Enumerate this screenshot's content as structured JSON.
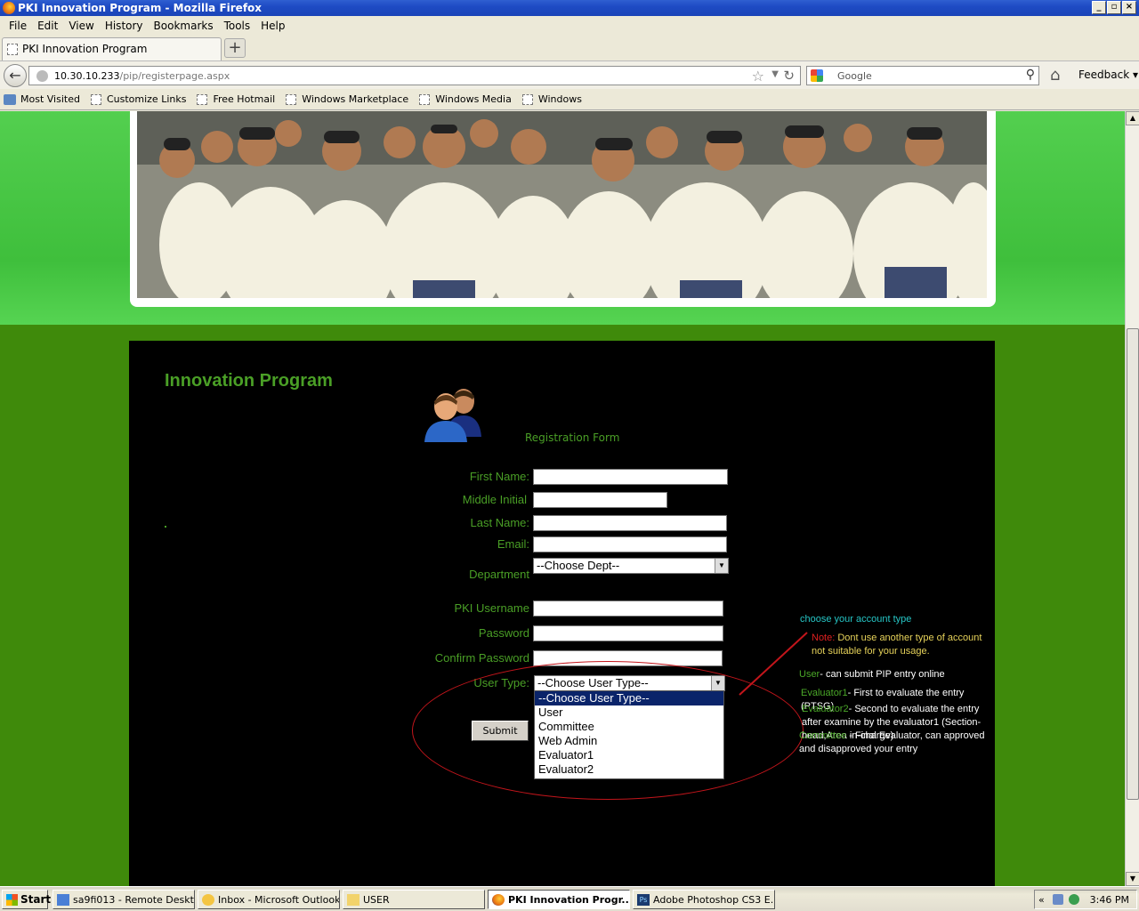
{
  "window": {
    "title": "PKI Innovation Program - Mozilla Firefox",
    "controls": [
      "_",
      "▫",
      "×"
    ]
  },
  "menu": [
    "File",
    "Edit",
    "View",
    "History",
    "Bookmarks",
    "Tools",
    "Help"
  ],
  "tab": {
    "label": "PKI Innovation Program",
    "new_tab": "+"
  },
  "nav": {
    "url_host": "10.30.10.233",
    "url_path": "/pip/registerpage.aspx",
    "search_placeholder": "Google",
    "feedback": "Feedback"
  },
  "bookmarks": [
    "Most Visited",
    "Customize Links",
    "Free Hotmail",
    "Windows Marketplace",
    "Windows Media",
    "Windows"
  ],
  "page": {
    "program_title": "Innovation Program",
    "form_title": "Registration Form",
    "labels": {
      "first_name": "First Name:",
      "middle_initial": "Middle Initial",
      "last_name": "Last Name:",
      "email": "Email:",
      "department": "Department",
      "username": "PKI Username",
      "password": "Password",
      "confirm_password": "Confirm Password",
      "user_type": "User Type:"
    },
    "department_select": "--Choose Dept--",
    "user_type_select": "--Choose User Type--",
    "user_type_options": [
      "--Choose User Type--",
      "User",
      "Committee",
      "Web Admin",
      "Evaluator1",
      "Evaluator2"
    ],
    "submit_label": "Submit",
    "notes": {
      "heading": "choose your account type",
      "note_label": "Note:",
      "note_text_1": "Dont use another type of account",
      "note_text_2": "not suitable for your usage.",
      "user_label": "User",
      "user_text": "- can submit PIP entry online",
      "eval1_label": "Evaluator1",
      "eval1_text": "- First to evaluate the entry (PTSG)",
      "eval2_label": "Evaluator2",
      "eval2_text": "- Second to evaluate the entry",
      "eval2_text_2": "after examine by the evaluator1 (Section-head,Area in-charge)",
      "committee_label": "Committee",
      "committee_text": "- Final Evaluator, can approved",
      "committee_text_2": "and disapproved your entry"
    }
  },
  "taskbar": {
    "start": "Start",
    "buttons": [
      "sa9fi013 - Remote Desktop",
      "Inbox - Microsoft Outlook",
      "USER",
      "PKI Innovation Progr...",
      "Adobe Photoshop CS3 E..."
    ],
    "tray_chevron": "«",
    "clock": "3:46 PM"
  },
  "colors": {
    "accent_green": "#4a9f26",
    "panel_bg": "#000000",
    "annotation_red": "#c2151b"
  }
}
